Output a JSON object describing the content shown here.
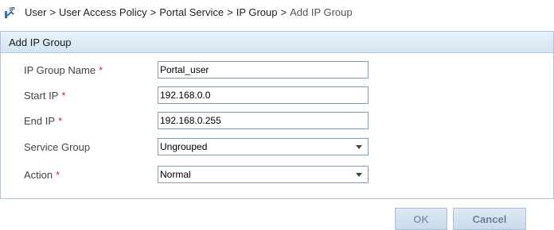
{
  "breadcrumb": {
    "icon": "ip-group-icon",
    "items": [
      "User",
      "User Access Policy",
      "Portal Service",
      "IP Group",
      "Add IP Group"
    ],
    "separator": ">"
  },
  "panel": {
    "title": "Add IP Group"
  },
  "form": {
    "ip_group_name": {
      "label": "IP Group Name",
      "required": "*",
      "value": "Portal_user"
    },
    "start_ip": {
      "label": "Start IP",
      "required": "*",
      "value": "192.168.0.0"
    },
    "end_ip": {
      "label": "End IP",
      "required": "*",
      "value": "192.168.0.255"
    },
    "service_group": {
      "label": "Service Group",
      "value": "Ungrouped"
    },
    "action": {
      "label": "Action",
      "required": "*",
      "value": "Normal"
    }
  },
  "buttons": {
    "ok": "OK",
    "cancel": "Cancel"
  },
  "colors": {
    "panel_border": "#a9c4dc",
    "header_bg": "#d4e4f2",
    "required": "#e02020",
    "button_bg": "#c9dbec"
  }
}
